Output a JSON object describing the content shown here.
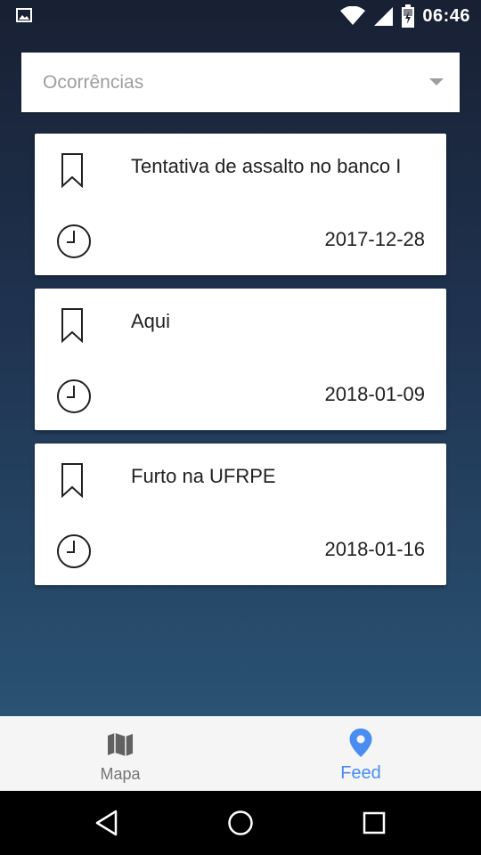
{
  "status_bar": {
    "time": "06:46",
    "icons": [
      "image-notification-icon",
      "wifi-icon",
      "signal-icon",
      "battery-charging-icon"
    ]
  },
  "filter": {
    "selected": "Ocorrências",
    "icon": "dropdown-arrow-icon"
  },
  "feed": {
    "items": [
      {
        "title": "Tentativa de assalto no banco I",
        "date": "2017-12-28"
      },
      {
        "title": "Aqui",
        "date": "2018-01-09"
      },
      {
        "title": "Furto na UFRPE",
        "date": "2018-01-16"
      }
    ]
  },
  "bottom_nav": {
    "tabs": [
      {
        "label": "Mapa",
        "icon": "map-icon",
        "active": false
      },
      {
        "label": "Feed",
        "icon": "location-pin-icon",
        "active": true
      }
    ]
  },
  "system_nav": {
    "buttons": [
      "back",
      "home",
      "recent-apps"
    ]
  },
  "colors": {
    "accent": "#4a8cf2",
    "inactive": "#757575",
    "background_top": "#182033",
    "background_bottom": "#2a5273"
  }
}
